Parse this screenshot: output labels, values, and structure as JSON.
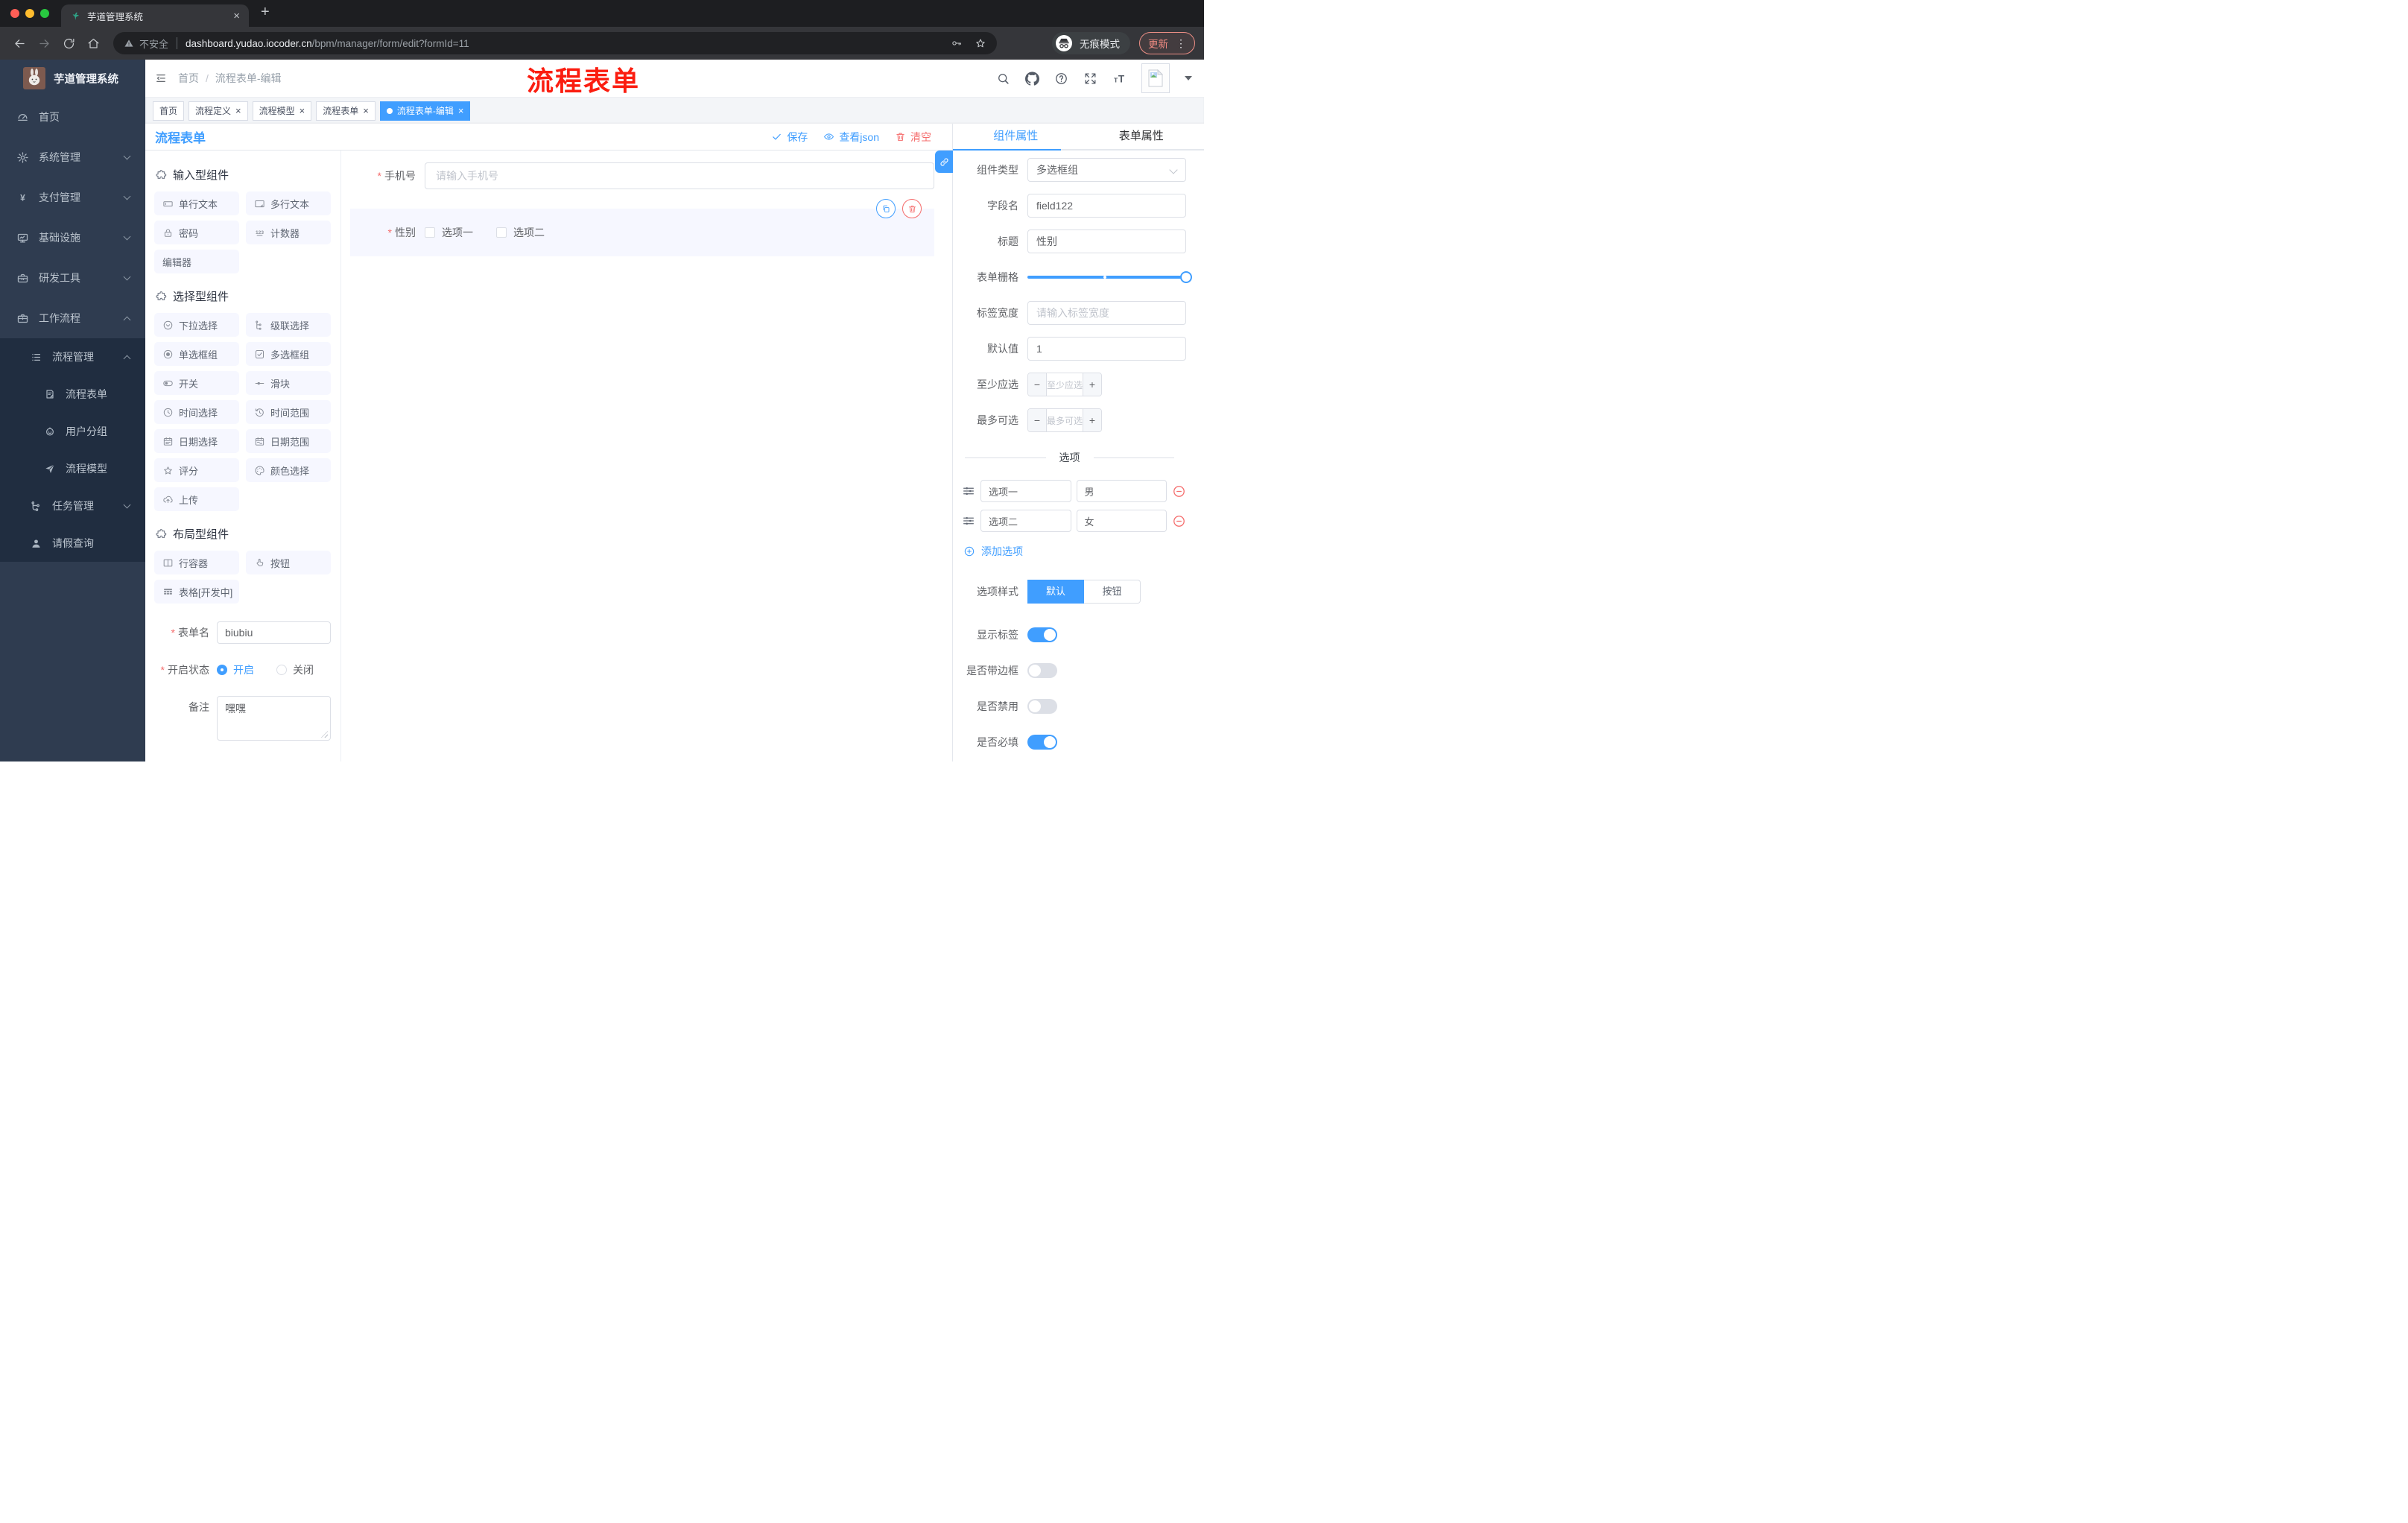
{
  "browser": {
    "tab_title": "芋道管理系统",
    "security_label": "不安全",
    "url_host": "dashboard.yudao.iocoder.cn",
    "url_path": "/bpm/manager/form/edit?formId=11",
    "incognito_label": "无痕模式",
    "update_label": "更新"
  },
  "watermark": "流程表单",
  "sidebar": {
    "logo_title": "芋道管理系统",
    "top_items": [
      {
        "label": "首页",
        "icon": "dashboard",
        "chev": ""
      },
      {
        "label": "系统管理",
        "icon": "gear",
        "chev": "down"
      },
      {
        "label": "支付管理",
        "icon": "yen",
        "chev": "down"
      },
      {
        "label": "基础设施",
        "icon": "infra",
        "chev": "down"
      },
      {
        "label": "研发工具",
        "icon": "tools",
        "chev": "down"
      },
      {
        "label": "工作流程",
        "icon": "workflow",
        "chev": "up"
      }
    ],
    "sub_items": [
      {
        "label": "流程管理",
        "icon": "listmenu",
        "chev": "up",
        "lvl": "lvl1"
      },
      {
        "label": "流程表单",
        "icon": "formdoc",
        "chev": "",
        "lvl": "lvl2"
      },
      {
        "label": "用户分组",
        "icon": "robot",
        "chev": "",
        "lvl": "lvl2"
      },
      {
        "label": "流程模型",
        "icon": "send",
        "chev": "",
        "lvl": "lvl2"
      },
      {
        "label": "任务管理",
        "icon": "tree",
        "chev": "down",
        "lvl": "lvl1"
      },
      {
        "label": "请假查询",
        "icon": "user",
        "chev": "",
        "lvl": "lvl1"
      }
    ]
  },
  "header": {
    "breadcrumb": [
      "首页",
      "流程表单-编辑"
    ]
  },
  "tags": [
    {
      "label": "首页",
      "closable": false,
      "active": false
    },
    {
      "label": "流程定义",
      "closable": true,
      "active": false
    },
    {
      "label": "流程模型",
      "closable": true,
      "active": false
    },
    {
      "label": "流程表单",
      "closable": true,
      "active": false
    },
    {
      "label": "流程表单-编辑",
      "closable": true,
      "active": true
    }
  ],
  "designer": {
    "title": "流程表单",
    "actions": {
      "save": "保存",
      "view_json": "查看json",
      "clear": "清空"
    },
    "palette": {
      "sections": [
        {
          "title": "输入型组件",
          "items": [
            {
              "label": "单行文本",
              "icon": "input"
            },
            {
              "label": "多行文本",
              "icon": "textarea"
            },
            {
              "label": "密码",
              "icon": "lock"
            },
            {
              "label": "计数器",
              "icon": "counter"
            },
            {
              "label": "编辑器",
              "icon": ""
            }
          ]
        },
        {
          "title": "选择型组件",
          "items": [
            {
              "label": "下拉选择",
              "icon": "select"
            },
            {
              "label": "级联选择",
              "icon": "cascader"
            },
            {
              "label": "单选框组",
              "icon": "radio"
            },
            {
              "label": "多选框组",
              "icon": "checkbox"
            },
            {
              "label": "开关",
              "icon": "switch"
            },
            {
              "label": "滑块",
              "icon": "slider"
            },
            {
              "label": "时间选择",
              "icon": "time"
            },
            {
              "label": "时间范围",
              "icon": "timerange"
            },
            {
              "label": "日期选择",
              "icon": "date"
            },
            {
              "label": "日期范围",
              "icon": "daterange"
            },
            {
              "label": "评分",
              "icon": "rate"
            },
            {
              "label": "颜色选择",
              "icon": "color"
            },
            {
              "label": "上传",
              "icon": "upload"
            }
          ]
        },
        {
          "title": "布局型组件",
          "items": [
            {
              "label": "行容器",
              "icon": "rowcol"
            },
            {
              "label": "按钮",
              "icon": "pointer"
            },
            {
              "label": "表格[开发中]",
              "icon": "table"
            }
          ]
        }
      ]
    },
    "meta_form": {
      "form_name_label": "表单名",
      "form_name_value": "biubiu",
      "status_label": "开启状态",
      "status_options": [
        {
          "label": "开启",
          "selected": true
        },
        {
          "label": "关闭",
          "selected": false
        }
      ],
      "remark_label": "备注",
      "remark_value": "嘿嘿"
    },
    "canvas": {
      "phone_field": {
        "label": "手机号",
        "placeholder": "请输入手机号"
      },
      "gender_field": {
        "label": "性别",
        "options": [
          "选项一",
          "选项二"
        ]
      }
    }
  },
  "properties": {
    "tabs": [
      {
        "label": "组件属性",
        "active": true
      },
      {
        "label": "表单属性",
        "active": false
      }
    ],
    "fields": {
      "component_type_label": "组件类型",
      "component_type_value": "多选框组",
      "field_name_label": "字段名",
      "field_name_value": "field122",
      "title_label": "标题",
      "title_value": "性别",
      "grid_label": "表单栅格",
      "label_width_label": "标签宽度",
      "label_width_placeholder": "请输入标签宽度",
      "default_label": "默认值",
      "default_value": "1",
      "min_label": "至少应选",
      "min_placeholder": "至少应选",
      "max_label": "最多可选",
      "max_placeholder": "最多可选"
    },
    "options_section": {
      "title": "选项",
      "rows": [
        {
          "label": "选项一",
          "value": "男"
        },
        {
          "label": "选项二",
          "value": "女"
        }
      ],
      "add_label": "添加选项"
    },
    "style_section": {
      "label": "选项样式",
      "options": [
        {
          "label": "默认",
          "active": true
        },
        {
          "label": "按钮",
          "active": false
        }
      ]
    },
    "switches": [
      {
        "label": "显示标签",
        "on": true
      },
      {
        "label": "是否带边框",
        "on": false
      },
      {
        "label": "是否禁用",
        "on": false
      },
      {
        "label": "是否必填",
        "on": true
      }
    ]
  },
  "colors": {
    "accent": "#409eff",
    "danger": "#f56c6c"
  }
}
